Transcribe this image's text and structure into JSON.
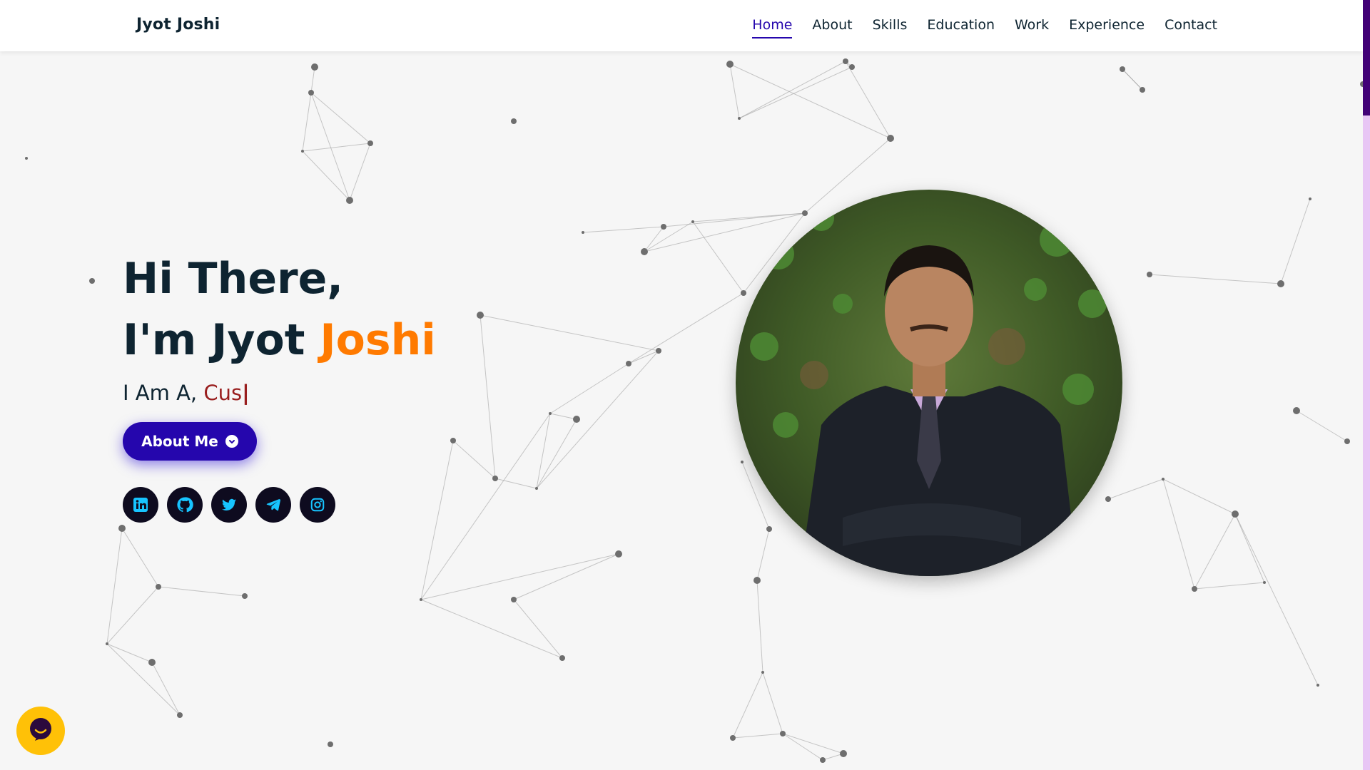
{
  "navbar": {
    "brand": "Jyot Joshi",
    "links": [
      "Home",
      "About",
      "Skills",
      "Education",
      "Work",
      "Experience",
      "Contact"
    ],
    "active": "Home"
  },
  "hero": {
    "greeting": "Hi There,",
    "name_prefix": "I'm Jyot ",
    "name_highlight": "Joshi",
    "typed_prefix": "I Am A, ",
    "typed_text": "Cus",
    "cursor": "|",
    "button_label": "About Me",
    "button_icon": "arrow-circle-down-icon"
  },
  "socials": [
    {
      "name": "linkedin-icon"
    },
    {
      "name": "github-icon"
    },
    {
      "name": "twitter-icon"
    },
    {
      "name": "telegram-icon"
    },
    {
      "name": "instagram-icon"
    }
  ],
  "profile_photo": {
    "subject": "Man in dark suit with arms crossed in front of green ivy wall"
  },
  "chat_widget": {
    "icon": "chat-bubble-icon"
  },
  "colors": {
    "primary": "#2506ad",
    "dark_text": "#0e2431",
    "accent_orange": "#ff7a00",
    "typed_red": "#991e1e",
    "social_bg": "#0e0b1f",
    "social_icon": "#17c4ff",
    "chat_yellow": "#ffc107",
    "scrollbar_thumb": "#420177",
    "scrollbar_track": "#e8c6f5"
  }
}
